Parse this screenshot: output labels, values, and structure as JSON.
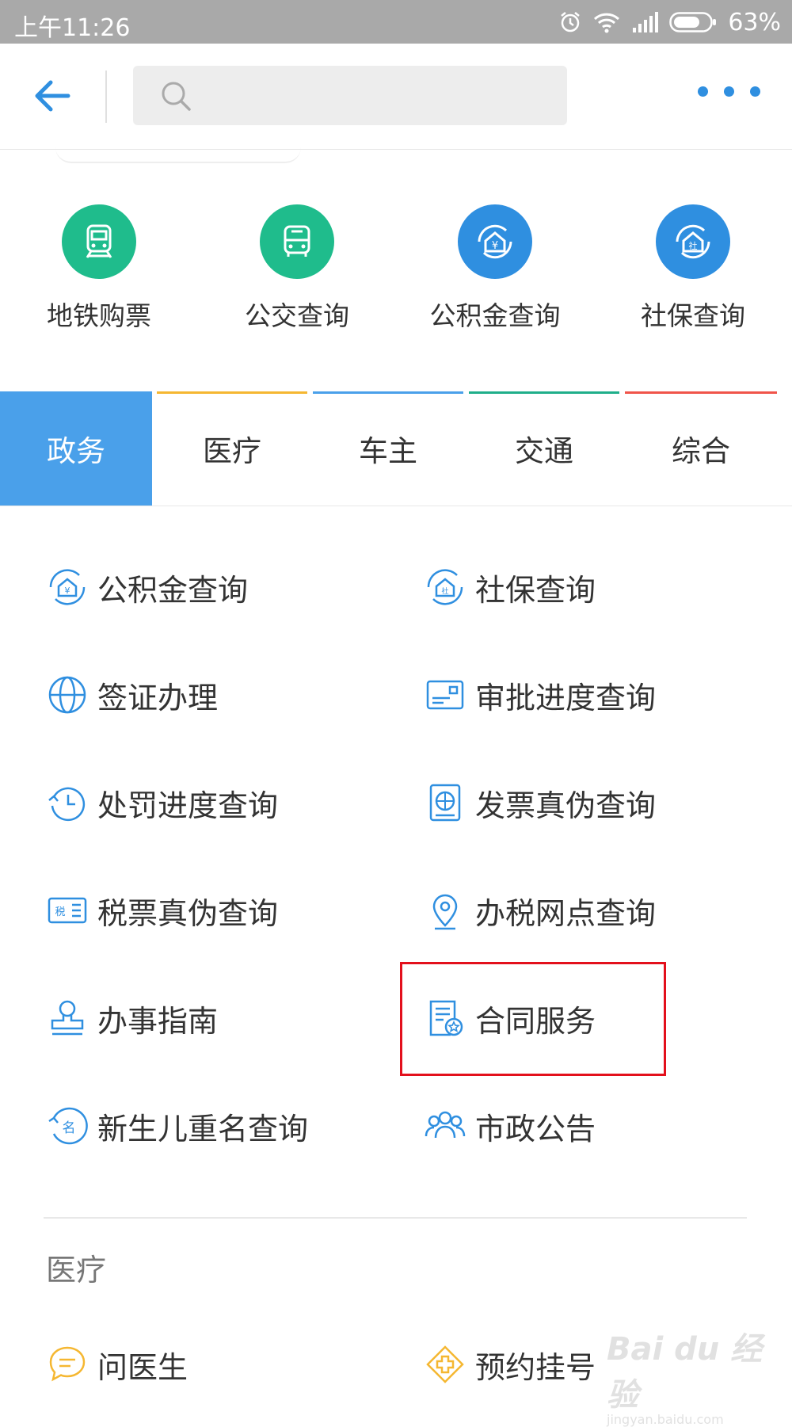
{
  "status_bar": {
    "time": "上午11:26",
    "battery": "63%"
  },
  "header": {
    "search": {
      "placeholder": ""
    }
  },
  "quick_services": [
    {
      "label": "地铁购票",
      "icon": "subway-icon",
      "color": "#1fbc8c"
    },
    {
      "label": "公交查询",
      "icon": "bus-icon",
      "color": "#1fbc8c"
    },
    {
      "label": "公积金查询",
      "icon": "housing-fund-icon",
      "color": "#2f8fe0"
    },
    {
      "label": "社保查询",
      "icon": "social-security-icon",
      "color": "#2f8fe0"
    }
  ],
  "tabs": [
    {
      "label": "政务",
      "active": true,
      "color": "#4aa0ea"
    },
    {
      "label": "医疗",
      "color": "#f5b731"
    },
    {
      "label": "车主",
      "color": "#4aa0ea"
    },
    {
      "label": "交通",
      "color": "#1fae8a"
    },
    {
      "label": "综合",
      "color": "#f0544a"
    }
  ],
  "government_services": [
    {
      "label": "公积金查询",
      "icon": "housing-fund-icon"
    },
    {
      "label": "社保查询",
      "icon": "social-security-icon"
    },
    {
      "label": "签证办理",
      "icon": "globe-icon"
    },
    {
      "label": "审批进度查询",
      "icon": "id-card-icon"
    },
    {
      "label": "处罚进度查询",
      "icon": "history-clock-icon"
    },
    {
      "label": "发票真伪查询",
      "icon": "invoice-icon"
    },
    {
      "label": "税票真伪查询",
      "icon": "tax-ticket-icon"
    },
    {
      "label": "办税网点查询",
      "icon": "location-pin-icon"
    },
    {
      "label": "办事指南",
      "icon": "stamp-icon"
    },
    {
      "label": "合同服务",
      "icon": "contract-icon",
      "highlighted": true
    },
    {
      "label": "新生儿重名查询",
      "icon": "name-tag-icon"
    },
    {
      "label": "市政公告",
      "icon": "people-group-icon"
    }
  ],
  "medical_section": {
    "title": "医疗",
    "items": [
      {
        "label": "问医生",
        "icon": "chat-bubble-icon",
        "color": "#f5b731"
      },
      {
        "label": "预约挂号",
        "icon": "medical-cross-icon",
        "color": "#f5b731"
      }
    ]
  },
  "watermark": {
    "logo_text": "Bai du 经验",
    "url_text": "jingyan.baidu.com"
  },
  "colors": {
    "accent": "#2f8fe0",
    "status_bar": "#a9a9a9",
    "highlight_box": "#e3101c"
  }
}
